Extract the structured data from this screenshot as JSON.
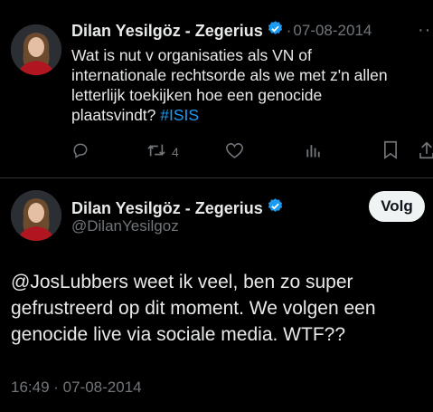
{
  "tweet1": {
    "author_name": "Dilan Yesilgöz - Zegerius",
    "separator": "·",
    "date": "07-08-2014",
    "text_lines": [
      "Wat is nut v organisaties als VN of",
      "internationale rechtsorde als we met z'n allen",
      "letterlijk toekijken hoe een genocide",
      "plaatsvindt?"
    ],
    "hashtag": "#ISIS",
    "retweet_count": "4",
    "icons": [
      "reply-icon",
      "retweet-icon",
      "like-icon",
      "views-icon",
      "bookmark-icon",
      "share-icon",
      "more-icon"
    ]
  },
  "tweet2": {
    "author_name": "Dilan Yesilgöz - Zegerius",
    "handle": "@DilanYesilgoz",
    "follow_label": "Volg",
    "text_lines": [
      "@JosLubbers weet ik veel, ben zo super",
      "gefrustreerd op dit moment. We volgen een",
      "genocide live via sociale media. WTF??"
    ],
    "timestamp": "16:49 · 07-08-2014"
  },
  "colors": {
    "background": "#000000",
    "text": "#e7e9ea",
    "muted": "#71767b",
    "accent": "#1d9bf0",
    "divider": "#2f3336"
  }
}
